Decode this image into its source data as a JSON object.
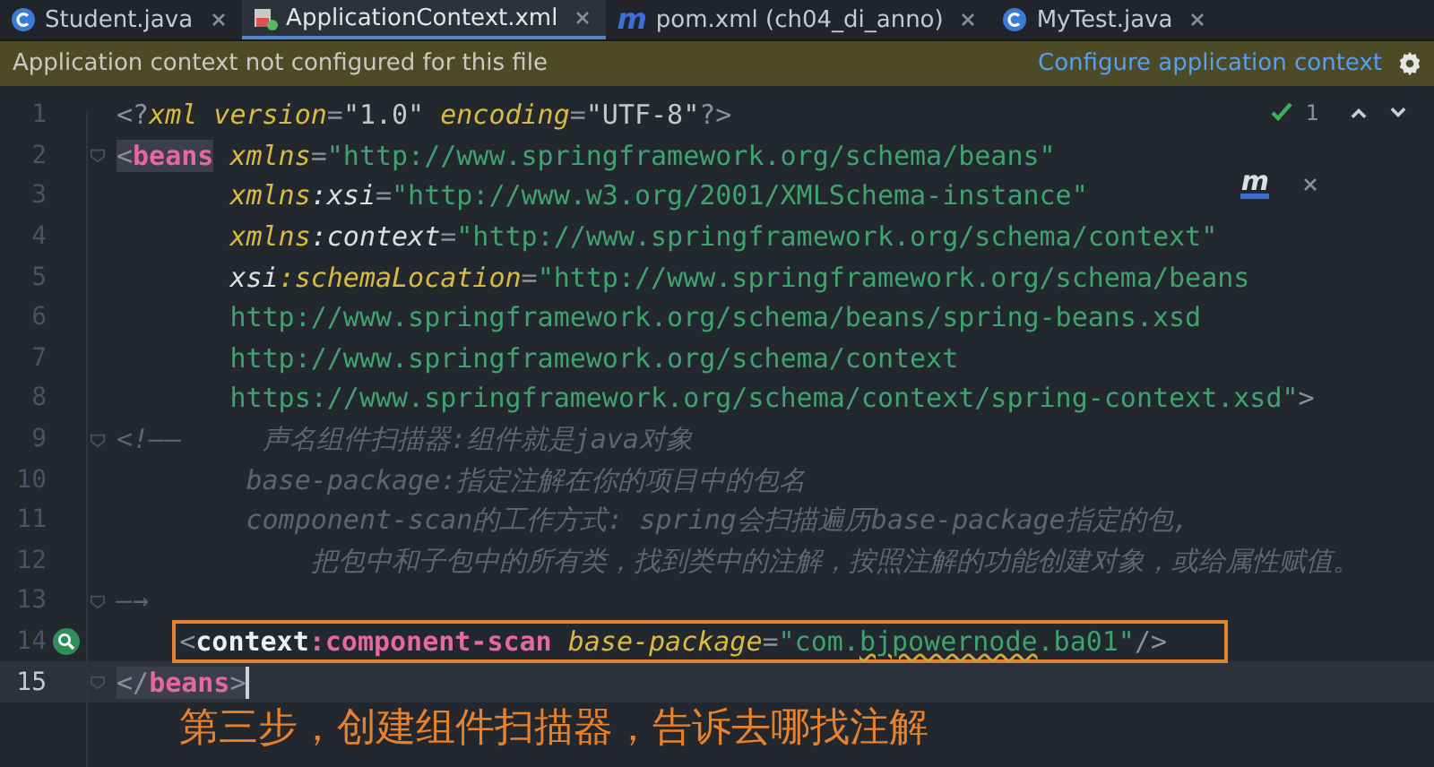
{
  "tabs": [
    {
      "label": "Student.java",
      "kind": "class",
      "selected": false
    },
    {
      "label": "ApplicationContext.xml",
      "kind": "xml",
      "selected": true
    },
    {
      "label": "pom.xml (ch04_di_anno)",
      "kind": "maven",
      "glyph": "m",
      "selected": false
    },
    {
      "label": "MyTest.java",
      "kind": "class",
      "selected": false
    }
  ],
  "notice": {
    "message": "Application context not configured for this file",
    "link": "Configure application context"
  },
  "inspection": {
    "count": "1"
  },
  "popup": {
    "glyph": "m"
  },
  "lines": [
    {
      "number": "1",
      "fold": false,
      "current": false,
      "boxed": false,
      "gutter_icon": false,
      "tokens": [
        {
          "kind": "punct",
          "text": "<?"
        },
        {
          "kind": "attr",
          "text": "xml"
        },
        {
          "kind": "attr",
          "text": " version"
        },
        {
          "kind": "punct",
          "text": "="
        },
        {
          "kind": "value",
          "text": "\"1.0\""
        },
        {
          "kind": "attr",
          "text": " encoding"
        },
        {
          "kind": "punct",
          "text": "="
        },
        {
          "kind": "value",
          "text": "\"UTF-8\""
        },
        {
          "kind": "punct",
          "text": "?>"
        }
      ]
    },
    {
      "number": "2",
      "fold": true,
      "current": false,
      "boxed": false,
      "gutter_icon": false,
      "tokens": [
        {
          "kind": "punct",
          "text": "<",
          "match": true
        },
        {
          "kind": "tag",
          "text": "beans",
          "match": true
        },
        {
          "kind": "attr",
          "text": " xmlns",
          "match": false
        },
        {
          "kind": "punct",
          "text": "=",
          "match": false
        },
        {
          "kind": "string",
          "text": "\"http://www.springframework.org/schema/beans\"",
          "match": false
        }
      ]
    },
    {
      "number": "3",
      "fold": false,
      "current": false,
      "boxed": false,
      "gutter_icon": false,
      "tokens": [
        {
          "kind": "attr",
          "text": "       xmlns"
        },
        {
          "kind": "ns",
          "text": ":xsi"
        },
        {
          "kind": "punct",
          "text": "="
        },
        {
          "kind": "string",
          "text": "\"http://www.w3.org/2001/XMLSchema-instance\""
        }
      ]
    },
    {
      "number": "4",
      "fold": false,
      "current": false,
      "boxed": false,
      "gutter_icon": false,
      "tokens": [
        {
          "kind": "attr",
          "text": "       xmlns"
        },
        {
          "kind": "ns",
          "text": ":context"
        },
        {
          "kind": "punct",
          "text": "="
        },
        {
          "kind": "string",
          "text": "\"http://www.springframework.org/schema/context\""
        }
      ]
    },
    {
      "number": "5",
      "fold": false,
      "current": false,
      "boxed": false,
      "gutter_icon": false,
      "tokens": [
        {
          "kind": "ns",
          "text": "       xsi"
        },
        {
          "kind": "attr",
          "text": ":schemaLocation"
        },
        {
          "kind": "punct",
          "text": "="
        },
        {
          "kind": "string",
          "text": "\"http://www.springframework.org/schema/beans"
        }
      ]
    },
    {
      "number": "6",
      "fold": false,
      "current": false,
      "boxed": false,
      "gutter_icon": false,
      "tokens": [
        {
          "kind": "string",
          "text": "       http://www.springframework.org/schema/beans/spring-beans.xsd"
        }
      ]
    },
    {
      "number": "7",
      "fold": false,
      "current": false,
      "boxed": false,
      "gutter_icon": false,
      "tokens": [
        {
          "kind": "string",
          "text": "       http://www.springframework.org/schema/context"
        }
      ]
    },
    {
      "number": "8",
      "fold": false,
      "current": false,
      "boxed": false,
      "gutter_icon": false,
      "tokens": [
        {
          "kind": "string",
          "text": "       https://www.springframework.org/schema/context/spring-context.xsd\""
        },
        {
          "kind": "punct",
          "text": ">"
        }
      ]
    },
    {
      "number": "9",
      "fold": true,
      "current": false,
      "boxed": false,
      "gutter_icon": false,
      "tokens": [
        {
          "kind": "comment",
          "text": "<!——     声名组件扫描器:组件就是java对象"
        }
      ]
    },
    {
      "number": "10",
      "fold": false,
      "current": false,
      "boxed": false,
      "gutter_icon": false,
      "tokens": [
        {
          "kind": "comment",
          "text": "        base-package:指定注解在你的项目中的包名"
        }
      ]
    },
    {
      "number": "11",
      "fold": false,
      "current": false,
      "boxed": false,
      "gutter_icon": false,
      "tokens": [
        {
          "kind": "comment",
          "text": "        component-scan的工作方式: spring会扫描遍历base-package指定的包,"
        }
      ]
    },
    {
      "number": "12",
      "fold": false,
      "current": false,
      "boxed": false,
      "gutter_icon": false,
      "tokens": [
        {
          "kind": "comment",
          "text": "            把包中和子包中的所有类，找到类中的注解，按照注解的功能创建对象，或给属性赋值。"
        }
      ]
    },
    {
      "number": "13",
      "fold": true,
      "current": false,
      "boxed": false,
      "gutter_icon": false,
      "tokens": [
        {
          "kind": "comment",
          "text": "—→"
        }
      ]
    },
    {
      "number": "14",
      "fold": false,
      "current": false,
      "boxed": true,
      "gutter_icon": true,
      "tokens": [
        {
          "kind": "punct",
          "text": "    <"
        },
        {
          "kind": "nstag",
          "text": "context"
        },
        {
          "kind": "tag",
          "text": ":component-scan"
        },
        {
          "kind": "attr",
          "text": " base-package"
        },
        {
          "kind": "punct",
          "text": "="
        },
        {
          "kind": "string",
          "text": "\"com."
        },
        {
          "kind": "typo",
          "text": "bjpowernode"
        },
        {
          "kind": "string",
          "text": ".ba01\""
        },
        {
          "kind": "punct",
          "text": "/>"
        }
      ]
    },
    {
      "number": "15",
      "fold": true,
      "current": true,
      "boxed": false,
      "gutter_icon": false,
      "tokens": [
        {
          "kind": "punct",
          "text": "</",
          "match": true
        },
        {
          "kind": "tag",
          "text": "beans",
          "match": true
        },
        {
          "kind": "punct",
          "text": ">",
          "match": true
        }
      ]
    }
  ],
  "caption": "第三步，创建组件扫描器，告诉去哪找注解"
}
